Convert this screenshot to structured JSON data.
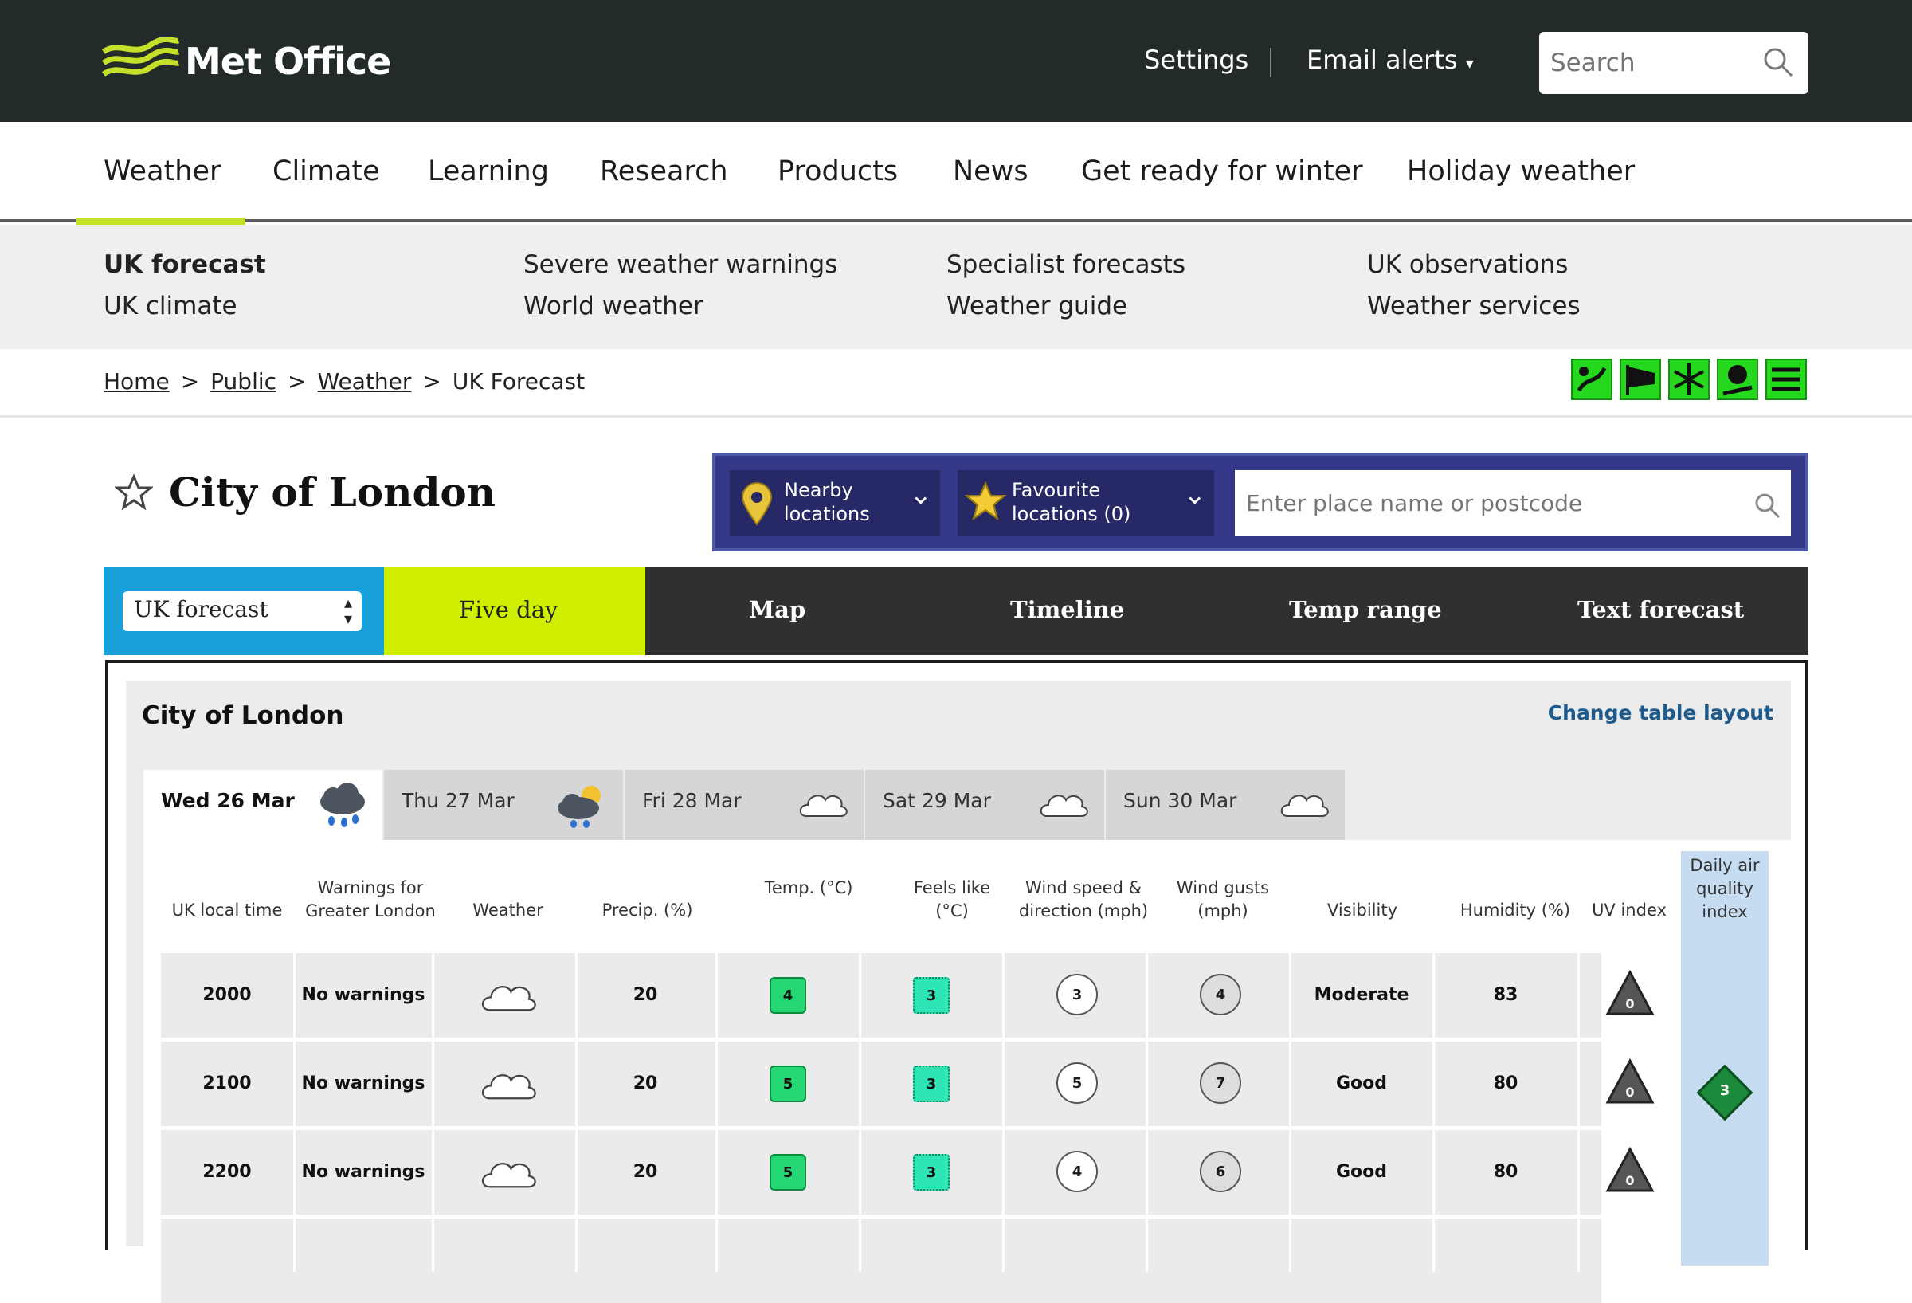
{
  "header": {
    "brand": "Met Office",
    "settings": "Settings",
    "email_alerts": "Email alerts",
    "search_placeholder": "Search"
  },
  "nav": {
    "items": [
      "Weather",
      "Climate",
      "Learning",
      "Research",
      "Products",
      "News",
      "Get ready for winter",
      "Holiday weather"
    ]
  },
  "subnav": {
    "items": [
      [
        "UK forecast",
        "UK climate"
      ],
      [
        "Severe weather warnings",
        "World weather"
      ],
      [
        "Specialist forecasts",
        "Weather guide"
      ],
      [
        "UK observations",
        "Weather services"
      ]
    ]
  },
  "breadcrumb": {
    "items": [
      "Home",
      "Public",
      "Weather",
      "UK Forecast"
    ],
    "sep": ">"
  },
  "location": {
    "title": "City of London",
    "nearby": "Nearby locations",
    "favourite": "Favourite locations (0)",
    "search_placeholder": "Enter place name or postcode"
  },
  "tabs": {
    "select": "UK forecast",
    "items": [
      "Five day",
      "Map",
      "Timeline",
      "Temp range",
      "Text forecast"
    ]
  },
  "panel": {
    "title": "City of London",
    "change_layout": "Change table layout"
  },
  "days": [
    {
      "label": "Wed 26 Mar",
      "icon": "rain-cloud-icon"
    },
    {
      "label": "Thu 27 Mar",
      "icon": "sun-cloud-rain-icon"
    },
    {
      "label": "Fri 28 Mar",
      "icon": "cloud-icon"
    },
    {
      "label": "Sat 29 Mar",
      "icon": "cloud-icon"
    },
    {
      "label": "Sun 30 Mar",
      "icon": "cloud-icon"
    }
  ],
  "table": {
    "headers": [
      "UK local time",
      "Warnings for Greater London",
      "Weather",
      "Precip. (%)",
      "Temp. (°C)",
      "Feels like (°C)",
      "Wind speed & direction (mph)",
      "Wind gusts (mph)",
      "Visibility",
      "Humidity (%)",
      "UV index",
      "Daily air quality index"
    ],
    "rows": [
      {
        "time": "2000",
        "warnings": "No warnings",
        "precip": "20",
        "temp": "4",
        "feels": "3",
        "wind": "3",
        "gust": "4",
        "visibility": "Moderate",
        "humidity": "83",
        "uv": "0"
      },
      {
        "time": "2100",
        "warnings": "No warnings",
        "precip": "20",
        "temp": "5",
        "feels": "3",
        "wind": "5",
        "gust": "7",
        "visibility": "Good",
        "humidity": "80",
        "uv": "0"
      },
      {
        "time": "2200",
        "warnings": "No warnings",
        "precip": "20",
        "temp": "5",
        "feels": "3",
        "wind": "4",
        "gust": "6",
        "visibility": "Good",
        "humidity": "80",
        "uv": "0"
      }
    ],
    "air_quality": "3"
  },
  "colors": {
    "topbar": "#222b2a",
    "accent": "#c4e02a",
    "tab_uk": "#1aa0d8",
    "tab_five": "#d1f000",
    "locbar": "#353789"
  }
}
